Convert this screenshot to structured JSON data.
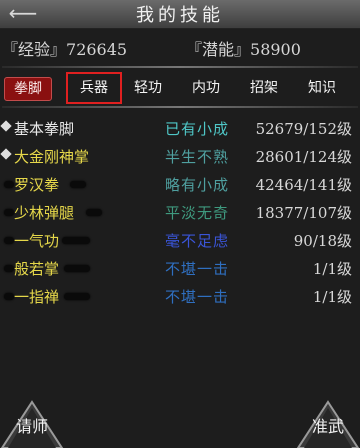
{
  "header": {
    "title": "我的技能",
    "back_icon": "back-arrow-icon"
  },
  "stats": {
    "exp_label": "『经验』",
    "exp_value": "726645",
    "pot_label": "『潜能』",
    "pot_value": "58900"
  },
  "tabs": [
    {
      "label": "拳脚",
      "active": true
    },
    {
      "label": "兵器",
      "highlight": true
    },
    {
      "label": "轻功"
    },
    {
      "label": "内功"
    },
    {
      "label": "招架"
    },
    {
      "label": "知识"
    }
  ],
  "skills": [
    {
      "name": "基本拳脚",
      "rank": "已有小成",
      "level": "52679/152级",
      "name_color": "#e8e8e8",
      "rank_color": "#4fc7c7",
      "bullet": true
    },
    {
      "name": "大金刚神掌",
      "rank": "半生不熟",
      "level": "28601/124级",
      "name_color": "#e6d84a",
      "rank_color": "#4fa0a0",
      "bullet": true
    },
    {
      "name": "罗汉拳",
      "rank": "略有小成",
      "level": "42464/141级",
      "name_color": "#e6d84a",
      "rank_color": "#4f9f9f",
      "bullet": false
    },
    {
      "name": "少林弹腿",
      "rank": "平淡无奇",
      "level": "18377/107级",
      "name_color": "#e6d84a",
      "rank_color": "#3f9a7f",
      "bullet": false
    },
    {
      "name": "一气功",
      "rank": "毫不足虑",
      "level": "90/18级",
      "name_color": "#e6d84a",
      "rank_color": "#3a55d8",
      "bullet": false
    },
    {
      "name": "般若掌",
      "rank": "不堪一击",
      "level": "1/1级",
      "name_color": "#e6d84a",
      "rank_color": "#2f6fc0",
      "bullet": false
    },
    {
      "name": "一指禅",
      "rank": "不堪一击",
      "level": "1/1级",
      "name_color": "#e6d84a",
      "rank_color": "#2f6fc0",
      "bullet": false
    }
  ],
  "buttons": {
    "left": "请师",
    "right": "准武"
  }
}
